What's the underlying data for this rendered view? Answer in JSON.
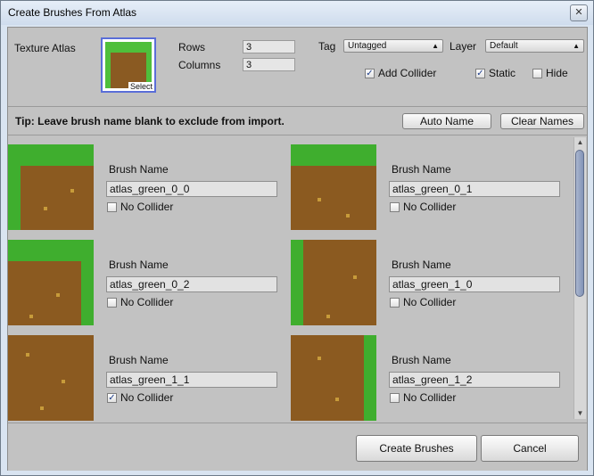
{
  "window": {
    "title": "Create Brushes From Atlas",
    "close_glyph": "✕"
  },
  "top": {
    "texture_atlas_label": "Texture Atlas",
    "select_label": "Select",
    "rows_label": "Rows",
    "rows_value": "3",
    "columns_label": "Columns",
    "columns_value": "3",
    "tag_label": "Tag",
    "tag_value": "Untagged",
    "layer_label": "Layer",
    "layer_value": "Default",
    "add_collider_label": "Add Collider",
    "add_collider_checked": true,
    "static_label": "Static",
    "static_checked": true,
    "hide_label": "Hide",
    "hide_checked": false
  },
  "tipbar": {
    "tip": "Tip: Leave brush name blank to exclude from import.",
    "auto_name_label": "Auto Name",
    "clear_names_label": "Clear Names"
  },
  "brush_name_label": "Brush Name",
  "no_collider_label": "No Collider",
  "brushes": [
    {
      "name": "atlas_green_0_0",
      "no_collider": false
    },
    {
      "name": "atlas_green_0_1",
      "no_collider": false
    },
    {
      "name": "atlas_green_0_2",
      "no_collider": false
    },
    {
      "name": "atlas_green_1_0",
      "no_collider": false
    },
    {
      "name": "atlas_green_1_1",
      "no_collider": true
    },
    {
      "name": "atlas_green_1_2",
      "no_collider": false
    }
  ],
  "footer": {
    "create_label": "Create Brushes",
    "cancel_label": "Cancel"
  },
  "colors": {
    "grass": "#3fae2e",
    "dirt": "#8b5a20",
    "panel": "#c2c2c2",
    "scroll_thumb": "#8293b6"
  }
}
